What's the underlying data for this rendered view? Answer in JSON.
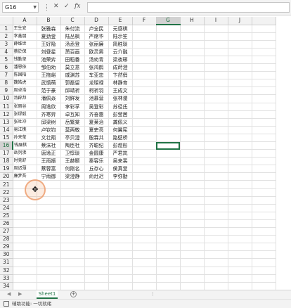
{
  "formula_bar": {
    "name_box": "G16",
    "fx_label": "fx",
    "cancel_glyph": "✕",
    "enter_glyph": "✓",
    "formula_value": ""
  },
  "columns": [
    "A",
    "B",
    "C",
    "D",
    "E",
    "F",
    "G",
    "H",
    "I",
    "J"
  ],
  "selected_cell": "G16",
  "rows": [
    [
      "王生安",
      "张雅森",
      "朱付流",
      "卢全民",
      "元感棋"
    ],
    [
      "李鑫朋",
      "夏劲釜",
      "陆丛枫",
      "严席华",
      "陆示笙"
    ],
    [
      "薛维世",
      "王好隐",
      "汤丞登",
      "张丽廉",
      "简胜琰"
    ],
    [
      "蔡於保",
      "刘昼星",
      "萧百画",
      "欧灵男",
      "云介融"
    ],
    [
      "钱勤坚",
      "池荣弈",
      "田稻番",
      "汤劝青",
      "梁夜琊"
    ],
    [
      "潘恩依",
      "邹伯劝",
      "莫立意",
      "张鸿鹤",
      "成莳澄"
    ],
    [
      "陈国柏",
      "王拖峪",
      "戚渊苏",
      "车亚忠",
      "卞然俏"
    ],
    [
      "魏皓虎",
      "武慎萌",
      "郭磊留",
      "龙璨禄",
      "林静育"
    ],
    [
      "周卓浩",
      "范于豪",
      "邱靖祈",
      "柯祈羽",
      "王成文"
    ],
    [
      "汤辟邦",
      "潘佩焱",
      "刘鲜发",
      "池慕营",
      "张林谡"
    ],
    [
      "张丽谷",
      "周逸欣",
      "李彩孚",
      "吴登彩",
      "苏径氐"
    ],
    [
      "张缪毅",
      "齐寒昇",
      "卓互知",
      "齐奋惠",
      "彭莹茜"
    ],
    [
      "张吐冲",
      "邱梁树",
      "岳繁棠",
      "夏莱治",
      "龚佩义"
    ],
    [
      "易江樵",
      "卢钦钧",
      "莫两敬",
      "夏吏亮",
      "何翼宪"
    ],
    [
      "孙来莹",
      "文壮翔",
      "亭贝澄",
      "殷霖共",
      "路壁桥"
    ],
    [
      "钱展棋",
      "蔡沫社",
      "陶臣杜",
      "齐聪纪",
      "彭煜彤"
    ],
    [
      "岳列沸",
      "唐逸正",
      "卫惇琰",
      "金圆康",
      "严君岚"
    ],
    [
      "时竞舒",
      "王雨振",
      "王赫颢",
      "秦容乐",
      "吴来裴"
    ],
    [
      "周迟薄",
      "蔡蓉富",
      "何刚名",
      "丘存心",
      "侯真堂"
    ],
    [
      "廉梦吾",
      "宁雨御",
      "梁澄静",
      "俞灶迟",
      "李弥勤"
    ],
    [
      "",
      "",
      "",
      "",
      ""
    ],
    [
      "",
      "",
      "",
      "",
      ""
    ],
    [
      "",
      "",
      "",
      "",
      ""
    ],
    [
      "",
      "",
      "",
      "",
      ""
    ],
    [
      "",
      "",
      "",
      "",
      ""
    ],
    [
      "",
      "",
      "",
      "",
      ""
    ],
    [
      "",
      "",
      "",
      "",
      ""
    ],
    [
      "",
      "",
      "",
      "",
      ""
    ],
    [
      "",
      "",
      "",
      "",
      ""
    ],
    [
      "",
      "",
      "",
      "",
      ""
    ],
    [
      "",
      "",
      "",
      "",
      ""
    ],
    [
      "",
      "",
      "",
      "",
      ""
    ],
    [
      "",
      "",
      "",
      "",
      ""
    ],
    [
      "",
      "",
      "",
      "",
      ""
    ]
  ],
  "sheet_tabs": [
    "Sheet1"
  ],
  "add_sheet_glyph": "+",
  "tab_more_glyph": "⋮",
  "status": {
    "text": "辅助功能: 一切就绪",
    "icon": "accessibility-icon"
  },
  "colors": {
    "accent": "#217346",
    "click_indicator": "#ec9662"
  },
  "cursor_icon": "move-cursor-icon"
}
